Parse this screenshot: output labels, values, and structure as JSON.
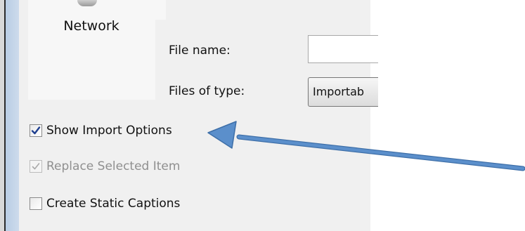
{
  "places": {
    "network_label": "Network"
  },
  "file_name": {
    "label": "File name:",
    "value": ""
  },
  "file_type": {
    "label": "Files of type:",
    "selected": "Importab"
  },
  "options": [
    {
      "label": "Show Import Options",
      "checked": true,
      "enabled": true
    },
    {
      "label": "Replace Selected Item",
      "checked": true,
      "enabled": false
    },
    {
      "label": "Create Static Captions",
      "checked": false,
      "enabled": true
    }
  ],
  "annotation": {
    "arrow_color": "#5b8fcb",
    "arrow_outline": "#3e6fa8"
  },
  "colors": {
    "dialog_bg": "#f0f0f0",
    "check_mark": "#1f3f8f",
    "disabled_text": "#8f8f8f"
  }
}
